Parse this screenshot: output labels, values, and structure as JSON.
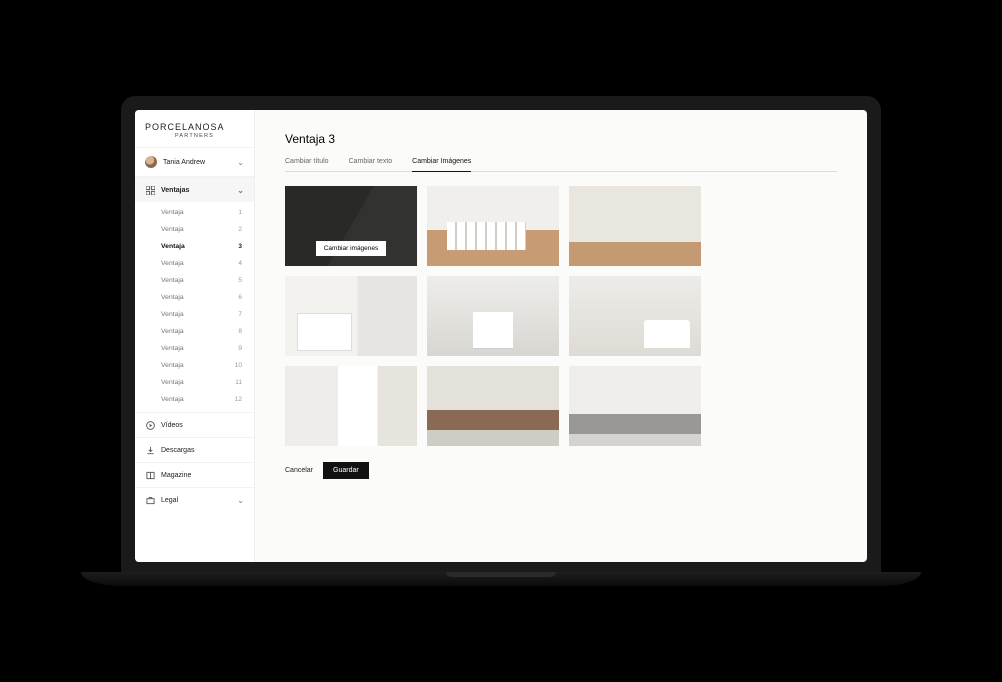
{
  "brand": {
    "main": "PORCELANOSA",
    "sub": "PARTNERS"
  },
  "user": {
    "name": "Tania Andrew"
  },
  "sidebar": {
    "ventajas_label": "Ventajas",
    "items": [
      {
        "label": "Ventaja",
        "num": "1"
      },
      {
        "label": "Ventaja",
        "num": "2"
      },
      {
        "label": "Ventaja",
        "num": "3"
      },
      {
        "label": "Ventaja",
        "num": "4"
      },
      {
        "label": "Ventaja",
        "num": "5"
      },
      {
        "label": "Ventaja",
        "num": "6"
      },
      {
        "label": "Ventaja",
        "num": "7"
      },
      {
        "label": "Ventaja",
        "num": "8"
      },
      {
        "label": "Ventaja",
        "num": "9"
      },
      {
        "label": "Ventaja",
        "num": "10"
      },
      {
        "label": "Ventaja",
        "num": "11"
      },
      {
        "label": "Ventaja",
        "num": "12"
      }
    ],
    "videos": "Vídeos",
    "descargas": "Descargas",
    "magazine": "Magazine",
    "legal": "Legal"
  },
  "page": {
    "title": "Ventaja 3",
    "tabs": {
      "titulo": "Cambiar título",
      "texto": "Cambiar texto",
      "imagenes": "Cambiar Imágenes"
    },
    "overlay_button": "Cambiar imágenes",
    "cancel": "Cancelar",
    "save": "Guardar"
  }
}
